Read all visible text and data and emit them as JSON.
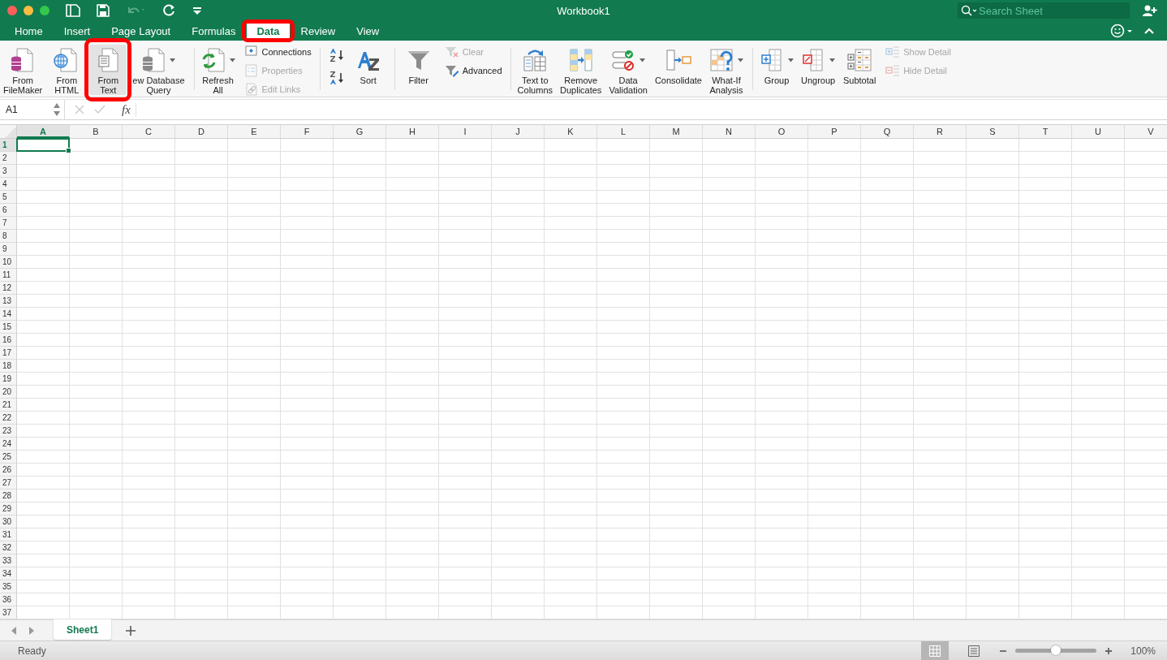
{
  "window": {
    "title": "Workbook1"
  },
  "search": {
    "placeholder": "Search Sheet"
  },
  "tabs": [
    {
      "label": "Home",
      "selected": false,
      "highlighted": false
    },
    {
      "label": "Insert",
      "selected": false,
      "highlighted": false
    },
    {
      "label": "Page Layout",
      "selected": false,
      "highlighted": false
    },
    {
      "label": "Formulas",
      "selected": false,
      "highlighted": false
    },
    {
      "label": "Data",
      "selected": true,
      "highlighted": true
    },
    {
      "label": "Review",
      "selected": false,
      "highlighted": false
    },
    {
      "label": "View",
      "selected": false,
      "highlighted": false
    }
  ],
  "ribbon": {
    "groups": [
      {
        "items": [
          {
            "kind": "large",
            "label": [
              "From",
              "FileMaker"
            ],
            "dropdown": false,
            "highlighted": false
          },
          {
            "kind": "large",
            "label": [
              "From",
              "HTML"
            ],
            "dropdown": false,
            "highlighted": false
          },
          {
            "kind": "large",
            "label": [
              "From",
              "Text"
            ],
            "dropdown": false,
            "highlighted": true
          },
          {
            "kind": "large",
            "label": [
              "ew Database",
              "Query"
            ],
            "dropdown": true,
            "highlighted": false
          }
        ]
      },
      {
        "items": [
          {
            "kind": "large",
            "label": [
              "Refresh",
              "All"
            ],
            "dropdown": true,
            "highlighted": false
          },
          {
            "kind": "stack",
            "items": [
              {
                "label": "Connections",
                "disabled": false
              },
              {
                "label": "Properties",
                "disabled": true
              },
              {
                "label": "Edit Links",
                "disabled": true
              }
            ]
          }
        ]
      },
      {
        "items": [
          {
            "kind": "sort_buttons"
          },
          {
            "kind": "large",
            "label": [
              "Sort"
            ],
            "dropdown": false,
            "highlighted": false
          }
        ]
      },
      {
        "items": [
          {
            "kind": "large",
            "label": [
              "Filter"
            ],
            "dropdown": false,
            "highlighted": false
          },
          {
            "kind": "stack",
            "items": [
              {
                "label": "Clear",
                "disabled": true
              },
              {
                "label": "Advanced",
                "disabled": false
              }
            ]
          }
        ]
      },
      {
        "items": [
          {
            "kind": "large",
            "label": [
              "Text to",
              "Columns"
            ],
            "dropdown": false,
            "highlighted": false
          },
          {
            "kind": "large",
            "label": [
              "Remove",
              "Duplicates"
            ],
            "dropdown": false,
            "highlighted": false
          },
          {
            "kind": "large",
            "label": [
              "Data",
              "Validation"
            ],
            "dropdown": true,
            "highlighted": false
          },
          {
            "kind": "large",
            "label": [
              "Consolidate"
            ],
            "dropdown": false,
            "highlighted": false
          },
          {
            "kind": "large",
            "label": [
              "What-If",
              "Analysis"
            ],
            "dropdown": true,
            "highlighted": false
          }
        ]
      },
      {
        "items": [
          {
            "kind": "large",
            "label": [
              "Group"
            ],
            "dropdown": true,
            "highlighted": false
          },
          {
            "kind": "large",
            "label": [
              "Ungroup"
            ],
            "dropdown": true,
            "highlighted": false
          },
          {
            "kind": "large",
            "label": [
              "Subtotal"
            ],
            "dropdown": false,
            "highlighted": false
          },
          {
            "kind": "stack",
            "items": [
              {
                "label": "Show Detail",
                "disabled": true
              },
              {
                "label": "Hide Detail",
                "disabled": true
              }
            ]
          }
        ]
      }
    ]
  },
  "formula_bar": {
    "name_box": "A1",
    "function_label": "fx"
  },
  "columns": [
    {
      "label": "A",
      "selected": true
    },
    {
      "label": "B",
      "selected": false
    },
    {
      "label": "C",
      "selected": false
    },
    {
      "label": "D",
      "selected": false
    },
    {
      "label": "E",
      "selected": false
    },
    {
      "label": "F",
      "selected": false
    },
    {
      "label": "G",
      "selected": false
    },
    {
      "label": "H",
      "selected": false
    },
    {
      "label": "I",
      "selected": false
    },
    {
      "label": "J",
      "selected": false
    },
    {
      "label": "K",
      "selected": false
    },
    {
      "label": "L",
      "selected": false
    },
    {
      "label": "M",
      "selected": false
    },
    {
      "label": "N",
      "selected": false
    },
    {
      "label": "O",
      "selected": false
    },
    {
      "label": "P",
      "selected": false
    },
    {
      "label": "Q",
      "selected": false
    },
    {
      "label": "R",
      "selected": false
    },
    {
      "label": "S",
      "selected": false
    },
    {
      "label": "T",
      "selected": false
    },
    {
      "label": "U",
      "selected": false
    },
    {
      "label": "V",
      "selected": false
    }
  ],
  "rows": [
    {
      "label": "1",
      "selected": true
    },
    {
      "label": "2",
      "selected": false
    },
    {
      "label": "3",
      "selected": false
    },
    {
      "label": "4",
      "selected": false
    },
    {
      "label": "5",
      "selected": false
    },
    {
      "label": "6",
      "selected": false
    },
    {
      "label": "7",
      "selected": false
    },
    {
      "label": "8",
      "selected": false
    },
    {
      "label": "9",
      "selected": false
    },
    {
      "label": "10",
      "selected": false
    },
    {
      "label": "11",
      "selected": false
    },
    {
      "label": "12",
      "selected": false
    },
    {
      "label": "13",
      "selected": false
    },
    {
      "label": "14",
      "selected": false
    },
    {
      "label": "15",
      "selected": false
    },
    {
      "label": "16",
      "selected": false
    },
    {
      "label": "17",
      "selected": false
    },
    {
      "label": "18",
      "selected": false
    },
    {
      "label": "19",
      "selected": false
    },
    {
      "label": "20",
      "selected": false
    },
    {
      "label": "21",
      "selected": false
    },
    {
      "label": "22",
      "selected": false
    },
    {
      "label": "23",
      "selected": false
    },
    {
      "label": "24",
      "selected": false
    },
    {
      "label": "25",
      "selected": false
    },
    {
      "label": "26",
      "selected": false
    },
    {
      "label": "27",
      "selected": false
    },
    {
      "label": "28",
      "selected": false
    },
    {
      "label": "29",
      "selected": false
    },
    {
      "label": "30",
      "selected": false
    },
    {
      "label": "31",
      "selected": false
    },
    {
      "label": "32",
      "selected": false
    },
    {
      "label": "33",
      "selected": false
    },
    {
      "label": "34",
      "selected": false
    },
    {
      "label": "35",
      "selected": false
    },
    {
      "label": "36",
      "selected": false
    },
    {
      "label": "37",
      "selected": false
    }
  ],
  "sheet_tabs": [
    {
      "label": "Sheet1",
      "selected": true
    }
  ],
  "status_bar": {
    "text": "Ready",
    "views": [
      {
        "kind": "normal",
        "selected": true
      },
      {
        "kind": "page_layout",
        "selected": false
      }
    ],
    "zoom": {
      "level": 0.5,
      "reading": "100%"
    }
  }
}
